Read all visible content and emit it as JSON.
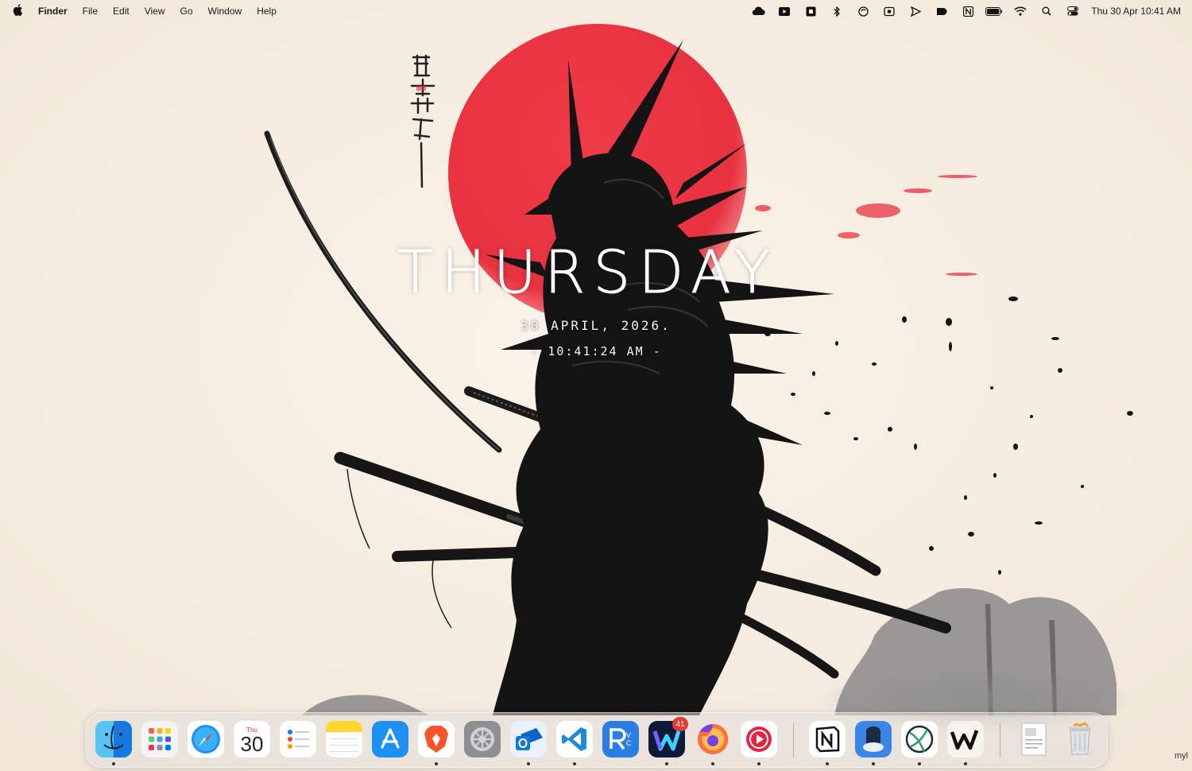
{
  "menubar": {
    "apple_icon": "apple-icon",
    "app_name": "Finder",
    "menus": [
      "File",
      "Edit",
      "View",
      "Go",
      "Window",
      "Help"
    ],
    "status_icons": [
      "cloud-icon",
      "youtube-icon",
      "screen-capture-icon",
      "bluetooth-icon",
      "sync-icon",
      "cube-icon",
      "send-icon",
      "drive-icon",
      "notion-icon",
      "battery-icon",
      "wifi-icon",
      "search-icon",
      "control-center-icon"
    ],
    "clock": "Thu 30 Apr  10:41 AM"
  },
  "overlay": {
    "day": "THURSDAY",
    "date": "30 APRIL, 2026.",
    "time": "- 10:41:24 AM -"
  },
  "wallpaper": {
    "sun_color": "#e8323f",
    "ink_color": "#111111"
  },
  "dock": {
    "apps": [
      {
        "name": "Finder",
        "icon": "finder-icon",
        "running": true
      },
      {
        "name": "Launchpad",
        "icon": "launchpad-icon",
        "running": false
      },
      {
        "name": "Safari",
        "icon": "safari-icon",
        "running": false
      },
      {
        "name": "Calendar",
        "icon": "calendar-icon",
        "running": false,
        "month": "Thu",
        "day": "30"
      },
      {
        "name": "Reminders",
        "icon": "reminders-icon",
        "running": false
      },
      {
        "name": "Notes",
        "icon": "notes-icon",
        "running": false
      },
      {
        "name": "App Store",
        "icon": "app-store-icon",
        "running": false
      },
      {
        "name": "Brave",
        "icon": "brave-icon",
        "running": true
      },
      {
        "name": "System Settings",
        "icon": "settings-icon",
        "running": false
      },
      {
        "name": "Outlook",
        "icon": "outlook-icon",
        "running": true
      },
      {
        "name": "VS Code",
        "icon": "vscode-icon",
        "running": true
      },
      {
        "name": "RealVNC",
        "icon": "vnc-icon",
        "running": false
      },
      {
        "name": "Wavebox",
        "icon": "wavebox-icon",
        "running": true,
        "badge": "41"
      },
      {
        "name": "Firefox",
        "icon": "firefox-icon",
        "running": true
      },
      {
        "name": "Cast",
        "icon": "cast-icon",
        "running": true
      },
      {
        "name": "Notion",
        "icon": "notion-icon",
        "running": true
      },
      {
        "name": "Container App",
        "icon": "container-icon",
        "running": true
      },
      {
        "name": "Network App",
        "icon": "network-icon",
        "running": true
      },
      {
        "name": "Writer",
        "icon": "writer-icon",
        "running": true
      },
      {
        "name": "Documents",
        "icon": "documents-icon",
        "running": false
      },
      {
        "name": "Trash",
        "icon": "trash-icon",
        "running": false
      }
    ]
  },
  "corner_text": "myl"
}
